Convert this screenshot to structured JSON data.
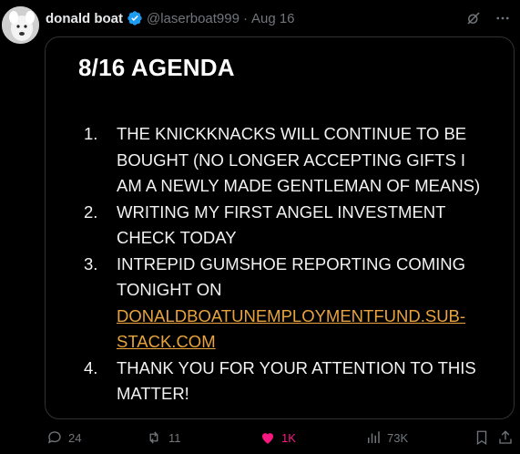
{
  "tweet": {
    "display_name": "donald boat",
    "handle": "@laserboat999",
    "separator": "·",
    "date": "Aug 16"
  },
  "card": {
    "title": "8/16 AGENDA",
    "items": [
      {
        "num": "1.",
        "text": "THE KNICKKNACKS WILL CONTINUE TO BE BOUGHT (NO LONGER ACCEPTING GIFTS I AM A NEWLY MADE GENTLEMAN OF MEANS)"
      },
      {
        "num": "2.",
        "text": "WRITING MY FIRST ANGEL INVESTMENT CHECK TODAY"
      },
      {
        "num": "3.",
        "text": "INTREPID GUMSHOE REPORTING COMING TONIGHT ON ",
        "link_line1": "DONALDBOATUNEMPLOYMENTFUND.SUB-",
        "link_line2": "STACK.COM"
      },
      {
        "num": "4.",
        "text": "THANK YOU FOR YOUR ATTENTION TO THIS MATTER!"
      }
    ]
  },
  "actions": {
    "replies": "24",
    "reposts": "11",
    "likes": "1K",
    "views": "73K"
  },
  "colors": {
    "background": "#000000",
    "verified": "#1d9bf0",
    "like": "#f91880",
    "link": "#e8a33d",
    "muted": "#71767b"
  },
  "icons": [
    "verified-badge-icon",
    "grok-icon",
    "more-icon",
    "reply-icon",
    "repost-icon",
    "like-icon",
    "views-icon",
    "bookmark-icon",
    "share-icon"
  ]
}
